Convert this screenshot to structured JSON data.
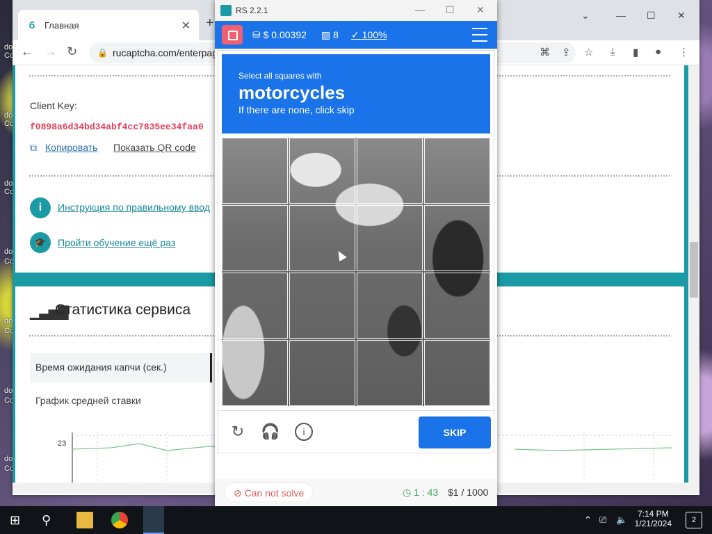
{
  "desktop": {
    "icon_labels": [
      "do",
      "Co",
      "do",
      "Co",
      "do",
      "Co",
      "do",
      "Co",
      "do",
      "Co",
      "do",
      "Co",
      "do",
      "Co"
    ]
  },
  "browser": {
    "tab_title": "Главная",
    "url": "rucaptcha.com/enterpag",
    "page": {
      "client_key_label": "Client Key:",
      "client_key_value": "f0898a6d34bd34abf4cc7835ee34faa0",
      "copy_link": "Копировать",
      "qr_link": "Показать QR code",
      "instructions_link": "Инструкция по правильному ввод",
      "training_link": "Пройти обучение ещё раз",
      "stats_title": "Статистика сервиса",
      "stats_tab_active": "Время ожидания капчи (сек.)",
      "stats_tab_2": "График средней ставки",
      "chart_y_tick": "23"
    }
  },
  "rs_window": {
    "title": "RS 2.2.1",
    "balance": "$ 0.00392",
    "count": "8",
    "percent": "100%",
    "captcha": {
      "line1": "Select all squares with",
      "target": "motorcycles",
      "line3": "If there are none, click skip",
      "grid_size": 4,
      "skip_label": "SKIP"
    },
    "cannot_solve": "Can not solve",
    "timer": "1 : 43",
    "limit": "$1 / 1000"
  },
  "taskbar": {
    "time": "7:14 PM",
    "date": "1/21/2024",
    "notifications": "2"
  }
}
